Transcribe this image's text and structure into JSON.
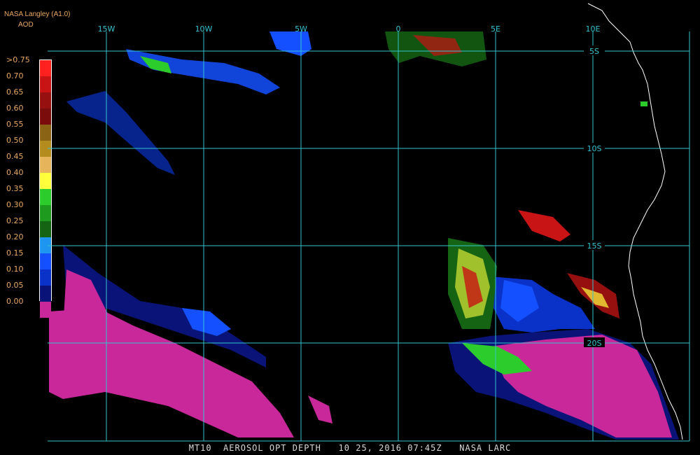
{
  "header": {
    "title": "NASA Langley (A1.0)",
    "subtitle": "AOD"
  },
  "legend": {
    "labels": [
      ">0.75",
      "0.70",
      "0.65",
      "0.60",
      "0.55",
      "0.50",
      "0.45",
      "0.40",
      "0.35",
      "0.30",
      "0.25",
      "0.20",
      "0.15",
      "0.10",
      "0.05",
      "0.00"
    ],
    "colors": [
      "#ff2020",
      "#c81414",
      "#961010",
      "#7a0c0c",
      "#8a6414",
      "#b48c1e",
      "#e6b45a",
      "#ffff3c",
      "#2ccc2c",
      "#1e9a1e",
      "#146414",
      "#1e96f0",
      "#1450ff",
      "#0a32c8",
      "#0a1478",
      "#c8289a"
    ]
  },
  "grid": {
    "longitude_labels": [
      "15W",
      "10W",
      "5W",
      "0",
      "5E",
      "10E"
    ],
    "latitude_labels": [
      "5S",
      "10S",
      "15S",
      "20S"
    ]
  },
  "footer": "MT10  AEROSOL OPT DEPTH   10 25, 2016 07:45Z   NASA LARC"
}
